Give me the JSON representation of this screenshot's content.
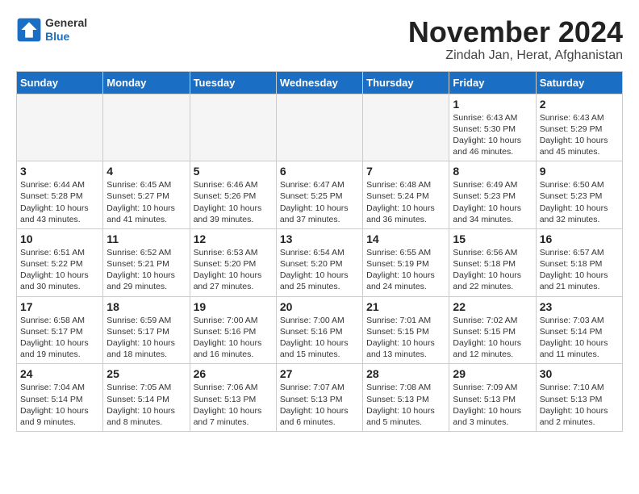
{
  "logo": {
    "general": "General",
    "blue": "Blue"
  },
  "title": "November 2024",
  "location": "Zindah Jan, Herat, Afghanistan",
  "days_header": [
    "Sunday",
    "Monday",
    "Tuesday",
    "Wednesday",
    "Thursday",
    "Friday",
    "Saturday"
  ],
  "weeks": [
    [
      {
        "day": "",
        "info": ""
      },
      {
        "day": "",
        "info": ""
      },
      {
        "day": "",
        "info": ""
      },
      {
        "day": "",
        "info": ""
      },
      {
        "day": "",
        "info": ""
      },
      {
        "day": "1",
        "info": "Sunrise: 6:43 AM\nSunset: 5:30 PM\nDaylight: 10 hours and 46 minutes."
      },
      {
        "day": "2",
        "info": "Sunrise: 6:43 AM\nSunset: 5:29 PM\nDaylight: 10 hours and 45 minutes."
      }
    ],
    [
      {
        "day": "3",
        "info": "Sunrise: 6:44 AM\nSunset: 5:28 PM\nDaylight: 10 hours and 43 minutes."
      },
      {
        "day": "4",
        "info": "Sunrise: 6:45 AM\nSunset: 5:27 PM\nDaylight: 10 hours and 41 minutes."
      },
      {
        "day": "5",
        "info": "Sunrise: 6:46 AM\nSunset: 5:26 PM\nDaylight: 10 hours and 39 minutes."
      },
      {
        "day": "6",
        "info": "Sunrise: 6:47 AM\nSunset: 5:25 PM\nDaylight: 10 hours and 37 minutes."
      },
      {
        "day": "7",
        "info": "Sunrise: 6:48 AM\nSunset: 5:24 PM\nDaylight: 10 hours and 36 minutes."
      },
      {
        "day": "8",
        "info": "Sunrise: 6:49 AM\nSunset: 5:23 PM\nDaylight: 10 hours and 34 minutes."
      },
      {
        "day": "9",
        "info": "Sunrise: 6:50 AM\nSunset: 5:23 PM\nDaylight: 10 hours and 32 minutes."
      }
    ],
    [
      {
        "day": "10",
        "info": "Sunrise: 6:51 AM\nSunset: 5:22 PM\nDaylight: 10 hours and 30 minutes."
      },
      {
        "day": "11",
        "info": "Sunrise: 6:52 AM\nSunset: 5:21 PM\nDaylight: 10 hours and 29 minutes."
      },
      {
        "day": "12",
        "info": "Sunrise: 6:53 AM\nSunset: 5:20 PM\nDaylight: 10 hours and 27 minutes."
      },
      {
        "day": "13",
        "info": "Sunrise: 6:54 AM\nSunset: 5:20 PM\nDaylight: 10 hours and 25 minutes."
      },
      {
        "day": "14",
        "info": "Sunrise: 6:55 AM\nSunset: 5:19 PM\nDaylight: 10 hours and 24 minutes."
      },
      {
        "day": "15",
        "info": "Sunrise: 6:56 AM\nSunset: 5:18 PM\nDaylight: 10 hours and 22 minutes."
      },
      {
        "day": "16",
        "info": "Sunrise: 6:57 AM\nSunset: 5:18 PM\nDaylight: 10 hours and 21 minutes."
      }
    ],
    [
      {
        "day": "17",
        "info": "Sunrise: 6:58 AM\nSunset: 5:17 PM\nDaylight: 10 hours and 19 minutes."
      },
      {
        "day": "18",
        "info": "Sunrise: 6:59 AM\nSunset: 5:17 PM\nDaylight: 10 hours and 18 minutes."
      },
      {
        "day": "19",
        "info": "Sunrise: 7:00 AM\nSunset: 5:16 PM\nDaylight: 10 hours and 16 minutes."
      },
      {
        "day": "20",
        "info": "Sunrise: 7:00 AM\nSunset: 5:16 PM\nDaylight: 10 hours and 15 minutes."
      },
      {
        "day": "21",
        "info": "Sunrise: 7:01 AM\nSunset: 5:15 PM\nDaylight: 10 hours and 13 minutes."
      },
      {
        "day": "22",
        "info": "Sunrise: 7:02 AM\nSunset: 5:15 PM\nDaylight: 10 hours and 12 minutes."
      },
      {
        "day": "23",
        "info": "Sunrise: 7:03 AM\nSunset: 5:14 PM\nDaylight: 10 hours and 11 minutes."
      }
    ],
    [
      {
        "day": "24",
        "info": "Sunrise: 7:04 AM\nSunset: 5:14 PM\nDaylight: 10 hours and 9 minutes."
      },
      {
        "day": "25",
        "info": "Sunrise: 7:05 AM\nSunset: 5:14 PM\nDaylight: 10 hours and 8 minutes."
      },
      {
        "day": "26",
        "info": "Sunrise: 7:06 AM\nSunset: 5:13 PM\nDaylight: 10 hours and 7 minutes."
      },
      {
        "day": "27",
        "info": "Sunrise: 7:07 AM\nSunset: 5:13 PM\nDaylight: 10 hours and 6 minutes."
      },
      {
        "day": "28",
        "info": "Sunrise: 7:08 AM\nSunset: 5:13 PM\nDaylight: 10 hours and 5 minutes."
      },
      {
        "day": "29",
        "info": "Sunrise: 7:09 AM\nSunset: 5:13 PM\nDaylight: 10 hours and 3 minutes."
      },
      {
        "day": "30",
        "info": "Sunrise: 7:10 AM\nSunset: 5:13 PM\nDaylight: 10 hours and 2 minutes."
      }
    ]
  ]
}
